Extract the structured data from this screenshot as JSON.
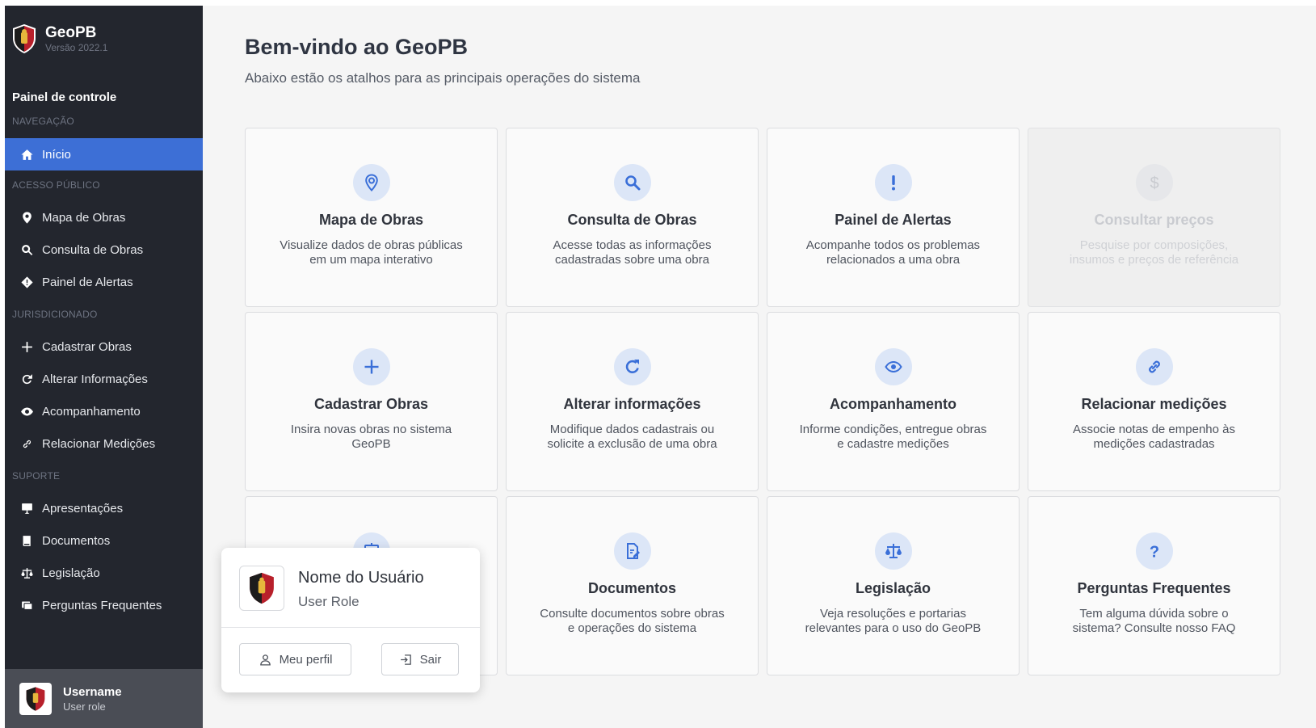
{
  "app": {
    "name": "GeoPB",
    "version": "Versão 2022.1"
  },
  "sidebar": {
    "panel_title": "Painel de controle",
    "sections": {
      "navegacao": "NAVEGAÇÃO",
      "acesso_publico": "ACESSO PÚBLICO",
      "jurisdicionado": "JURISDICIONADO",
      "suporte": "SUPORTE"
    },
    "items": [
      {
        "label": "Início",
        "icon": "home-icon",
        "active": true
      },
      {
        "label": "Mapa de Obras",
        "icon": "map-pin-icon"
      },
      {
        "label": "Consulta de Obras",
        "icon": "search-icon"
      },
      {
        "label": "Painel de Alertas",
        "icon": "alert-diamond-icon"
      },
      {
        "label": "Cadastrar Obras",
        "icon": "plus-icon"
      },
      {
        "label": "Alterar Informações",
        "icon": "refresh-icon"
      },
      {
        "label": "Acompanhamento",
        "icon": "eye-icon"
      },
      {
        "label": "Relacionar Medições",
        "icon": "link-icon"
      },
      {
        "label": "Apresentações",
        "icon": "presentation-icon"
      },
      {
        "label": "Documentos",
        "icon": "book-icon"
      },
      {
        "label": "Legislação",
        "icon": "scale-icon"
      },
      {
        "label": "Perguntas Frequentes",
        "icon": "faq-icon"
      }
    ],
    "footer_user": {
      "username": "Username",
      "role": "User role"
    }
  },
  "main": {
    "title": "Bem-vindo ao GeoPB",
    "subtitle": "Abaixo estão os atalhos para as principais operações do sistema",
    "cards": [
      {
        "title": "Mapa de Obras",
        "desc": "Visualize dados de obras públicas em um mapa interativo",
        "icon": "map-pin-icon"
      },
      {
        "title": "Consulta de Obras",
        "desc": "Acesse todas as informações cadastradas sobre uma obra",
        "icon": "search-icon"
      },
      {
        "title": "Painel de Alertas",
        "desc": "Acompanhe todos os problemas relacionados a uma obra",
        "icon": "exclamation-icon"
      },
      {
        "title": "Consultar preços",
        "desc": "Pesquise por composições, insumos e preços de referência",
        "icon": "dollar-icon",
        "disabled": true
      },
      {
        "title": "Cadastrar Obras",
        "desc": "Insira novas obras no sistema GeoPB",
        "icon": "plus-icon"
      },
      {
        "title": "Alterar informações",
        "desc": "Modifique dados cadastrais ou solicite a exclusão de uma obra",
        "icon": "refresh-icon"
      },
      {
        "title": "Acompanhamento",
        "desc": "Informe condições, entregue obras e cadastre medições",
        "icon": "eye-icon"
      },
      {
        "title": "Relacionar medições",
        "desc": "Associe notas de empenho às medições cadastradas",
        "icon": "link-icon"
      },
      {
        "title": "",
        "desc": "",
        "icon": "presentation-icon"
      },
      {
        "title": "Documentos",
        "desc": "Consulte documentos sobre obras e operações do sistema",
        "icon": "document-edit-icon"
      },
      {
        "title": "Legislação",
        "desc": "Veja resoluções e portarias relevantes para o uso do GeoPB",
        "icon": "scale-icon"
      },
      {
        "title": "Perguntas Frequentes",
        "desc": "Tem alguma dúvida sobre o sistema? Consulte nosso FAQ",
        "icon": "question-icon"
      }
    ]
  },
  "popup": {
    "name": "Nome do Usuário",
    "role": "User Role",
    "profile_button": "Meu perfil",
    "logout_button": "Sair"
  },
  "colors": {
    "sidebar_bg": "#23262e",
    "active_item": "#3d6fd6",
    "icon_blue": "#3a6fd8",
    "icon_circle": "#dce6f7"
  }
}
